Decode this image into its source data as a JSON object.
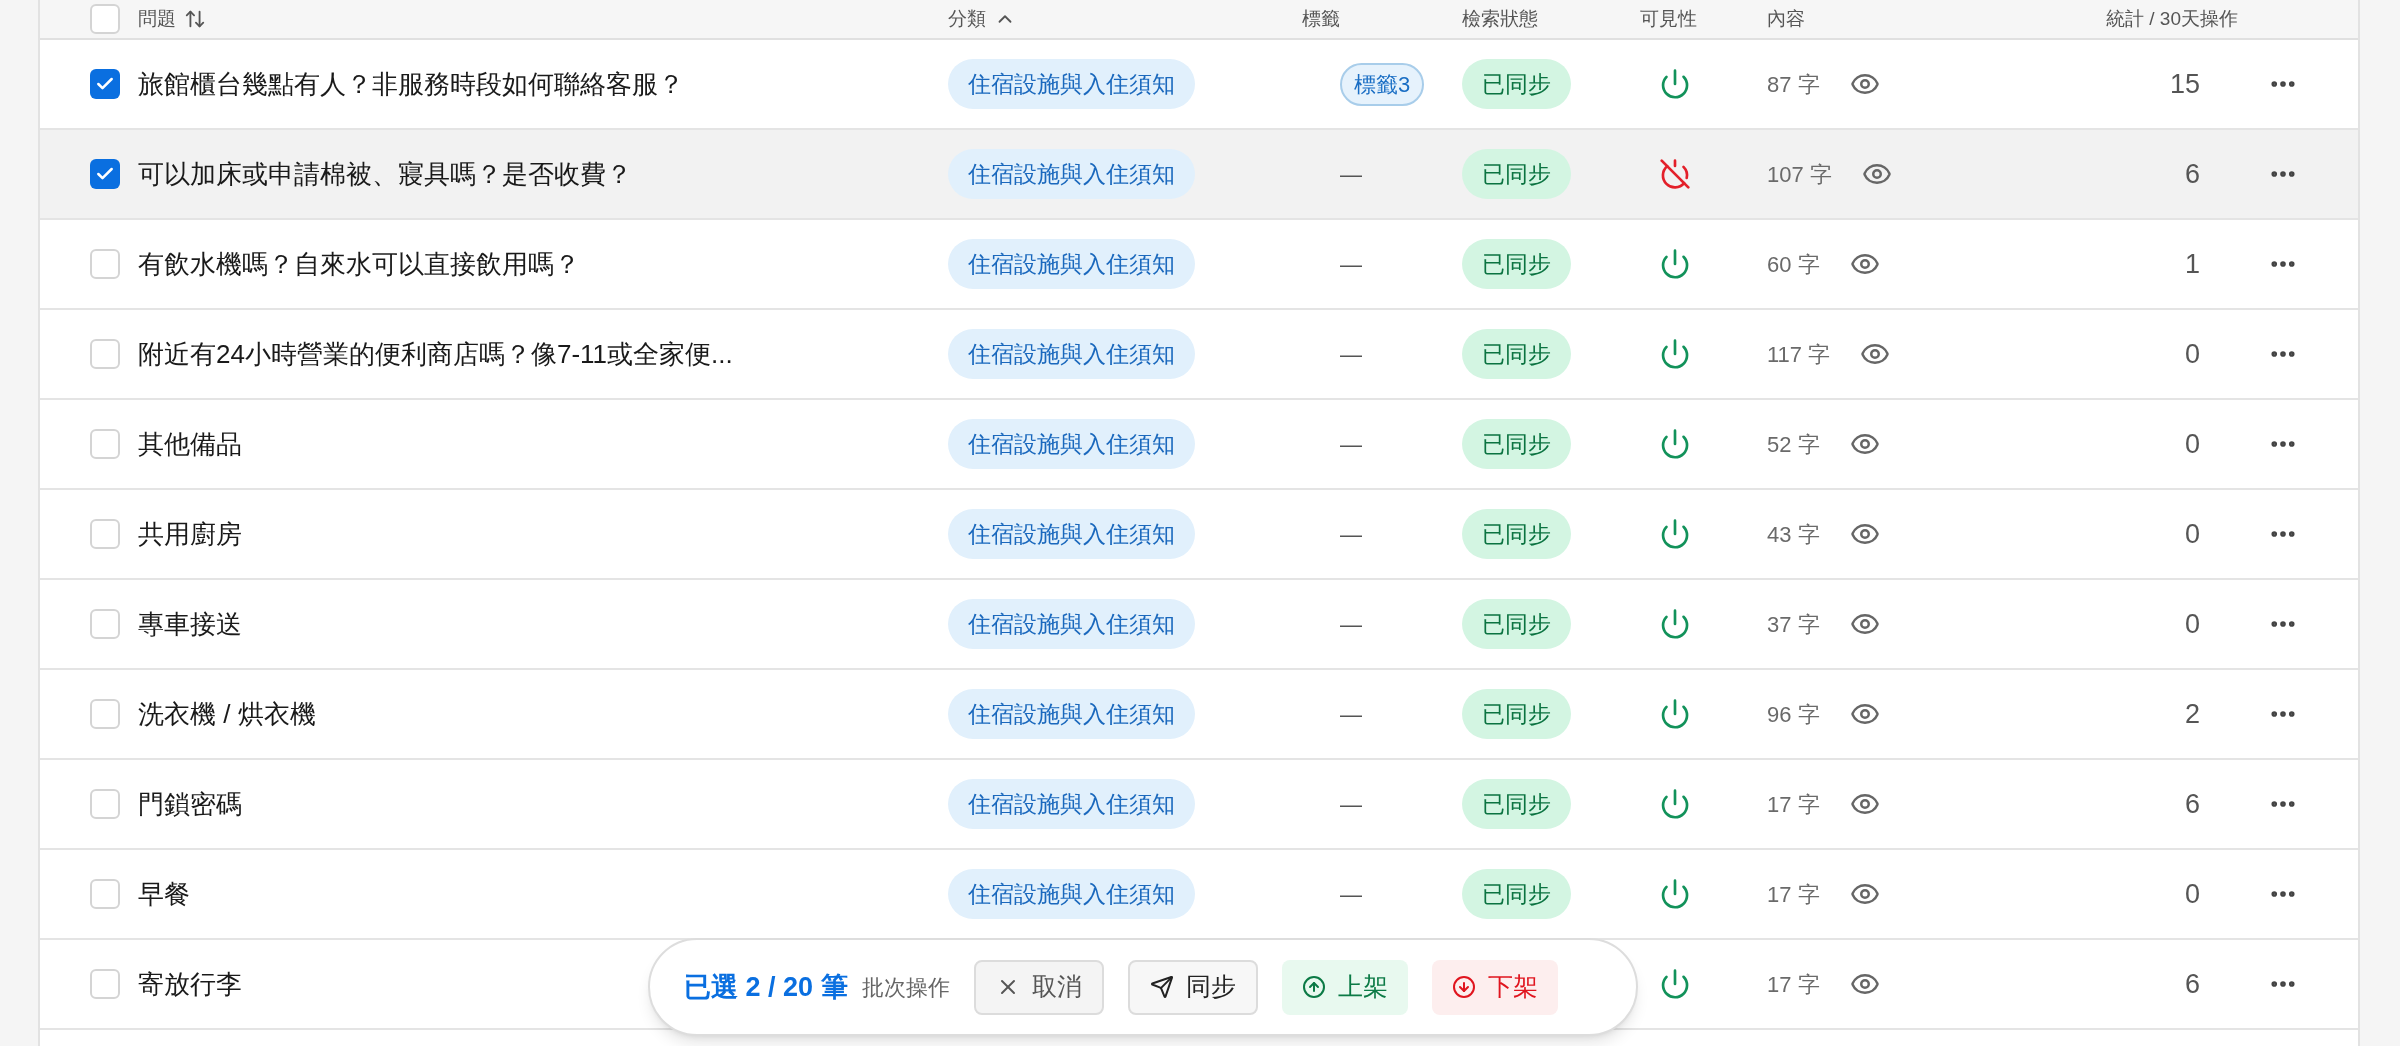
{
  "table": {
    "header": {
      "checked": false,
      "columns": [
        {
          "label": "問題",
          "kind": "sortable"
        },
        {
          "label": "分類",
          "kind": "sorted"
        },
        {
          "label": "標籤",
          "kind": "plain"
        },
        {
          "label": "檢索狀態",
          "kind": "plain"
        },
        {
          "label": "可見性",
          "kind": "plain"
        },
        {
          "label": "內容",
          "kind": "plain"
        },
        {
          "label": "統計 / 30天",
          "kind": "numeric"
        },
        {
          "label": "操作",
          "kind": "plain"
        }
      ]
    },
    "rows": [
      {
        "checked": true,
        "hovered": false,
        "question": "旅館櫃台幾點有人？非服務時段如何聯絡客服？",
        "category": "住宿設施與入住須知",
        "tag": {
          "kind": "pill",
          "text": "標籤3"
        },
        "status": "已同步",
        "visible": true,
        "length": "87 字",
        "stat": "15"
      },
      {
        "checked": true,
        "hovered": true,
        "question": "可以加床或申請棉被、寢具嗎？是否收費？",
        "category": "住宿設施與入住須知",
        "tag": {
          "kind": "none",
          "text": "—"
        },
        "status": "已同步",
        "visible": false,
        "length": "107 字",
        "stat": "6"
      },
      {
        "checked": false,
        "hovered": false,
        "question": "有飲水機嗎？自來水可以直接飲用嗎？",
        "category": "住宿設施與入住須知",
        "tag": {
          "kind": "none",
          "text": "—"
        },
        "status": "已同步",
        "visible": true,
        "length": "60 字",
        "stat": "1"
      },
      {
        "checked": false,
        "hovered": false,
        "question": "附近有24小時營業的便利商店嗎？像7-11或全家便...",
        "category": "住宿設施與入住須知",
        "tag": {
          "kind": "none",
          "text": "—"
        },
        "status": "已同步",
        "visible": true,
        "length": "117 字",
        "stat": "0"
      },
      {
        "checked": false,
        "hovered": false,
        "question": "其他備品",
        "category": "住宿設施與入住須知",
        "tag": {
          "kind": "none",
          "text": "—"
        },
        "status": "已同步",
        "visible": true,
        "length": "52 字",
        "stat": "0"
      },
      {
        "checked": false,
        "hovered": false,
        "question": "共用廚房",
        "category": "住宿設施與入住須知",
        "tag": {
          "kind": "none",
          "text": "—"
        },
        "status": "已同步",
        "visible": true,
        "length": "43 字",
        "stat": "0"
      },
      {
        "checked": false,
        "hovered": false,
        "question": "專車接送",
        "category": "住宿設施與入住須知",
        "tag": {
          "kind": "none",
          "text": "—"
        },
        "status": "已同步",
        "visible": true,
        "length": "37 字",
        "stat": "0"
      },
      {
        "checked": false,
        "hovered": false,
        "question": "洗衣機 / 烘衣機",
        "category": "住宿設施與入住須知",
        "tag": {
          "kind": "none",
          "text": "—"
        },
        "status": "已同步",
        "visible": true,
        "length": "96 字",
        "stat": "2"
      },
      {
        "checked": false,
        "hovered": false,
        "question": "門鎖密碼",
        "category": "住宿設施與入住須知",
        "tag": {
          "kind": "none",
          "text": "—"
        },
        "status": "已同步",
        "visible": true,
        "length": "17 字",
        "stat": "6"
      },
      {
        "checked": false,
        "hovered": false,
        "question": "早餐",
        "category": "住宿設施與入住須知",
        "tag": {
          "kind": "none",
          "text": "—"
        },
        "status": "已同步",
        "visible": true,
        "length": "17 字",
        "stat": "0"
      },
      {
        "checked": false,
        "hovered": false,
        "question": "寄放行李",
        "visible": true,
        "length": "17 字",
        "stat": "6"
      }
    ]
  },
  "bulk_bar": {
    "selection": "已選 2 / 20 筆",
    "label": "批次操作",
    "buttons": [
      {
        "kind": "cancel",
        "label": "取消"
      },
      {
        "kind": "sync",
        "label": "同步"
      },
      {
        "kind": "publish",
        "label": "上架"
      },
      {
        "kind": "unpublish",
        "label": "下架"
      }
    ]
  }
}
